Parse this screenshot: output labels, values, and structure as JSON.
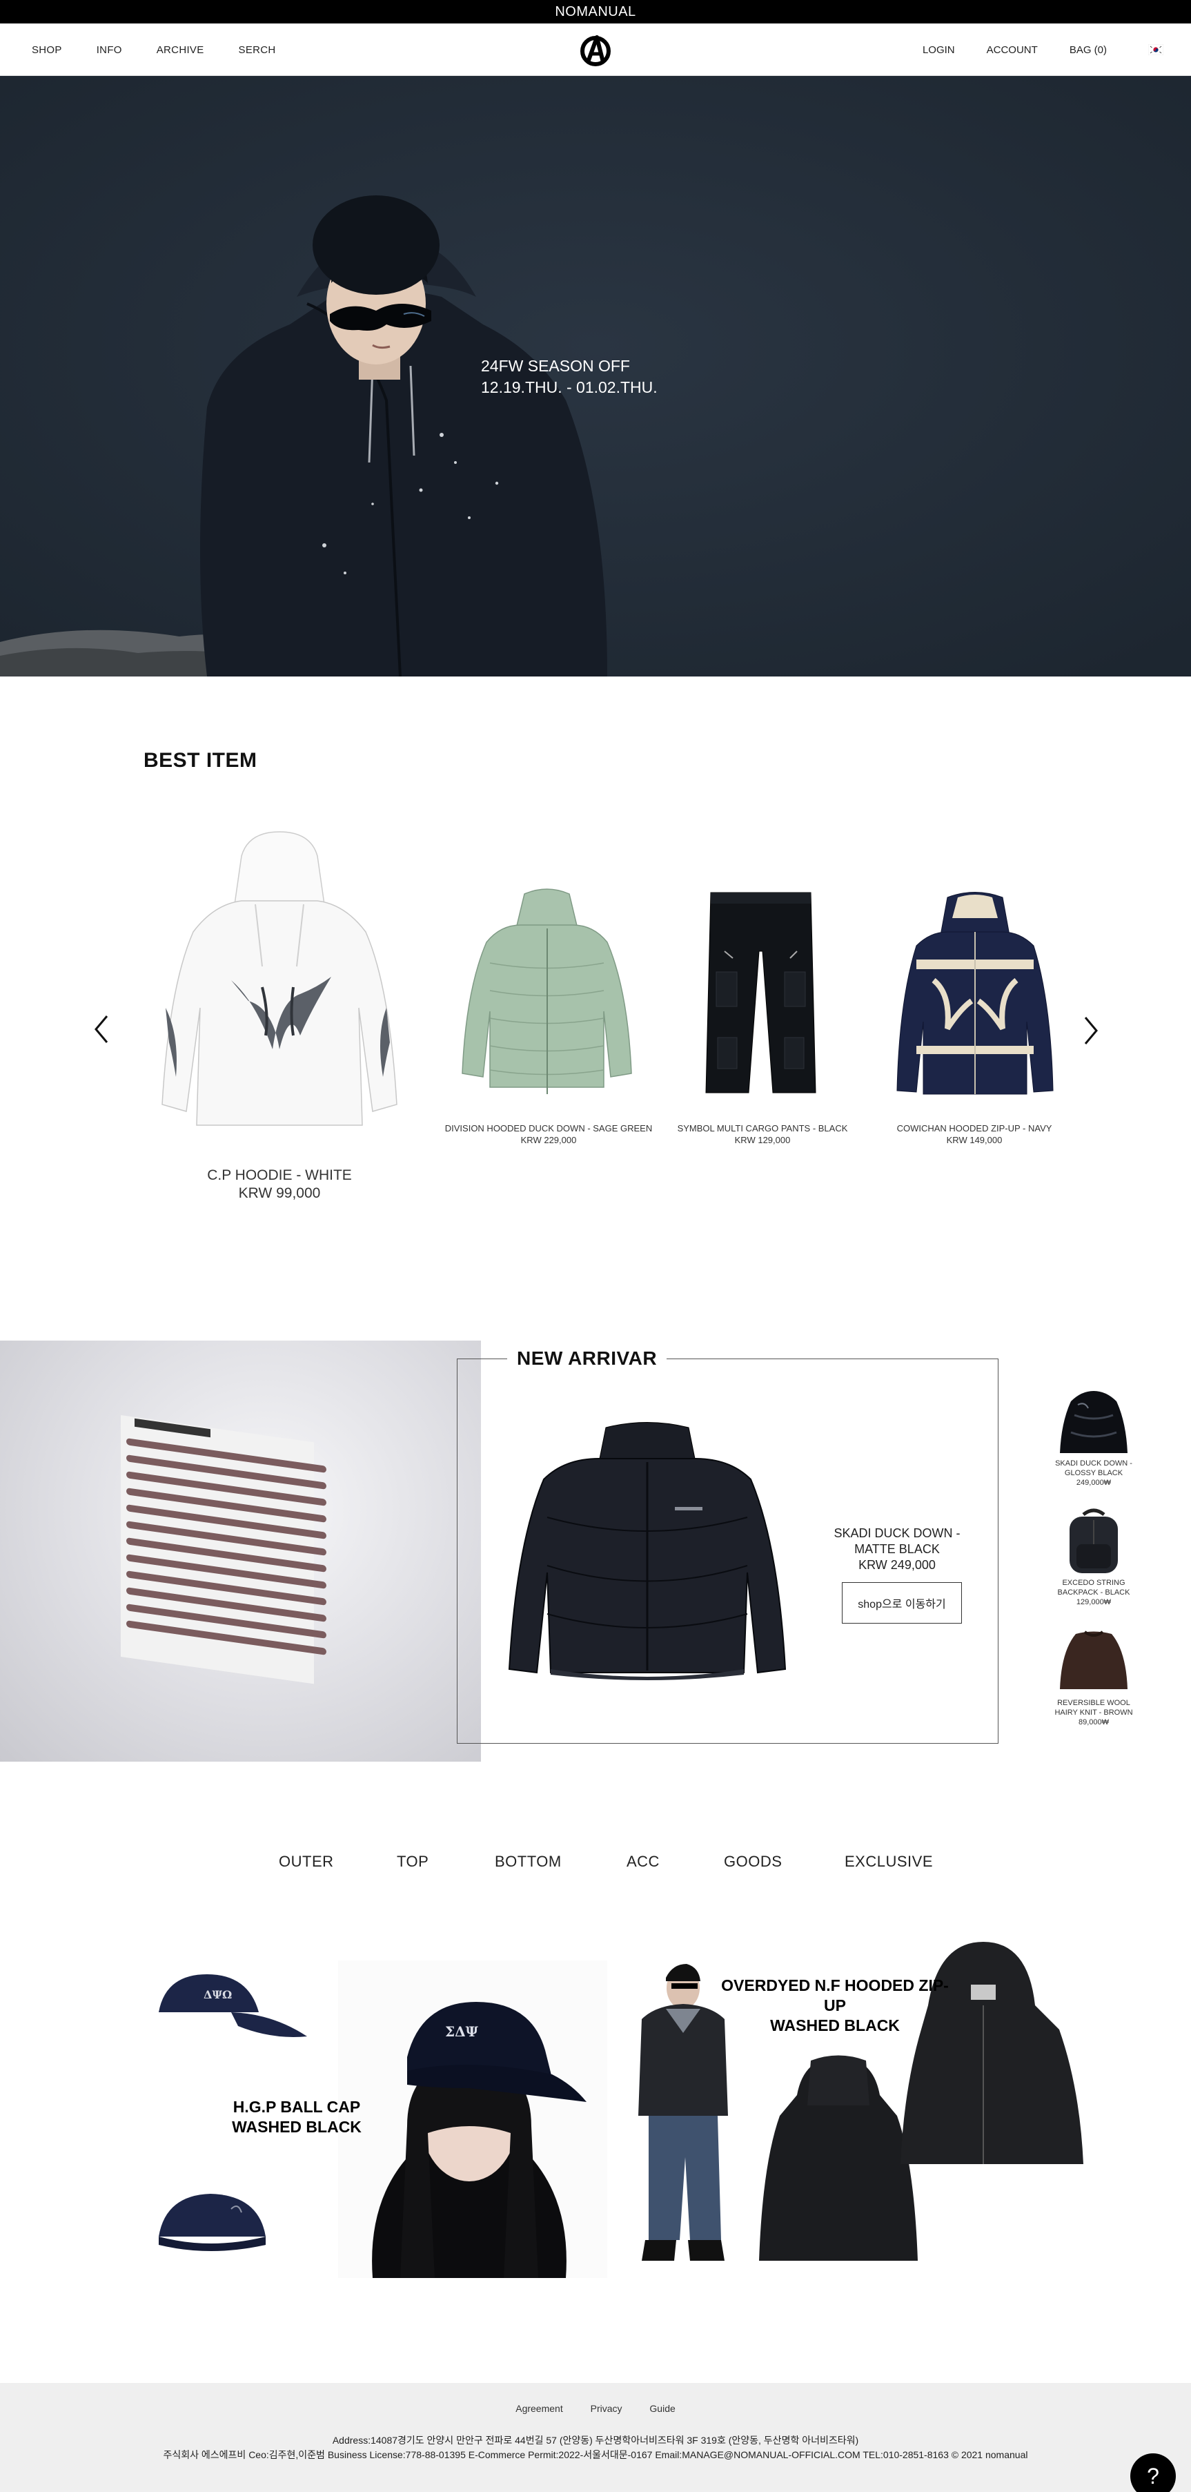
{
  "topbar": {
    "brand": "NOMANUAL"
  },
  "nav": {
    "left": [
      "SHOP",
      "INFO",
      "ARCHIVE",
      "SERCH"
    ],
    "login": "LOGIN",
    "account": "ACCOUNT",
    "bag": "BAG (0)"
  },
  "hero": {
    "line1": "24FW SEASON OFF",
    "line2": "12.19.THU. - 01.02.THU."
  },
  "best": {
    "title": "BEST ITEM",
    "items": [
      {
        "name": "C.P HOODIE - WHITE",
        "price": "KRW 99,000"
      },
      {
        "name": "DIVISION HOODED DUCK DOWN - SAGE GREEN",
        "price": "KRW 229,000"
      },
      {
        "name": "SYMBOL MULTI CARGO PANTS - BLACK",
        "price": "KRW 129,000"
      },
      {
        "name": "COWICHAN HOODED ZIP-UP - NAVY",
        "price": "KRW 149,000"
      }
    ]
  },
  "new_arrival": {
    "title": "NEW ARRIVAR",
    "name_line1": "SKADI DUCK DOWN -",
    "name_line2": "MATTE BLACK",
    "price": "KRW 249,000",
    "button": "shop으로 이동하기",
    "side": [
      {
        "l1": "SKADI DUCK DOWN -",
        "l2": "GLOSSY BLACK",
        "l3": "249,000₩"
      },
      {
        "l1": "EXCEDO STRING",
        "l2": "BACKPACK - BLACK",
        "l3": "129,000₩"
      },
      {
        "l1": "REVERSIBLE WOOL",
        "l2": "HAIRY KNIT - BROWN",
        "l3": "89,000₩"
      }
    ]
  },
  "categories": [
    "OUTER",
    "TOP",
    "BOTTOM",
    "ACC",
    "GOODS",
    "EXCLUSIVE"
  ],
  "promo": {
    "cap_l1": "H.G.P BALL CAP",
    "cap_l2": "WASHED BLACK",
    "zip_l1": "OVERDYED N.F HOODED ZIP-UP",
    "zip_l2": "WASHED BLACK"
  },
  "footer": {
    "links": [
      "Agreement",
      "Privacy",
      "Guide"
    ],
    "address": "Address:14087경기도 안양시 만안구 전파로 44번길 57 (안양동) 두산명학아너비즈타워 3F 319호 (안양동, 두산명학 아너비즈타워)",
    "company": "주식회사 에스에프비 Ceo:김주현,이준범 Business License:778-88-01395 E-Commerce Permit:2022-서울서대문-0167 Email:MANAGE@NOMANUAL-OFFICIAL.COM TEL:010-2851-8163 © 2021 nomanual",
    "help": "?"
  },
  "icons": {
    "logo": "nomanual-logo-icon",
    "flag": "korea-flag-icon",
    "prev": "chevron-left-icon",
    "next": "chevron-right-icon",
    "help": "help-icon"
  },
  "colors": {
    "hero_bg": "#202a36",
    "topbar_bg": "#000000",
    "footer_bg": "#efefef",
    "navy": "#1c2547"
  }
}
